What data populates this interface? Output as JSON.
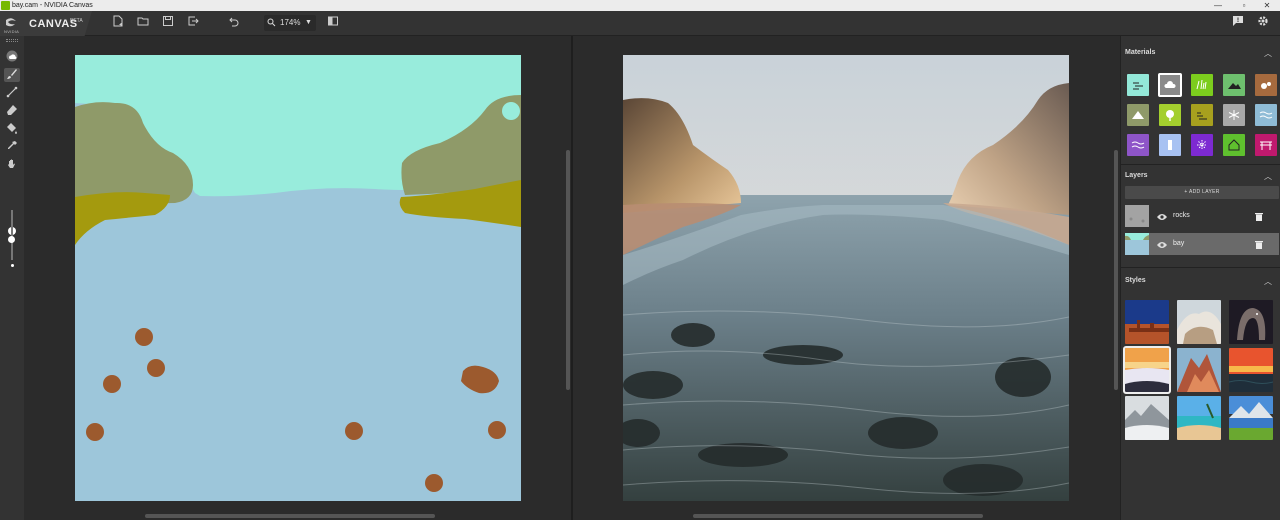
{
  "window": {
    "title": "bay.cam - NVIDIA Canvas",
    "controls": [
      "—",
      "▫",
      "✕"
    ]
  },
  "brand": {
    "logo_text": "NVIDIA",
    "app_name": "CANVAS",
    "badge": "BETA"
  },
  "toolbar": {
    "zoom_value": "174%",
    "icons": [
      "new-file-icon",
      "open-folder-icon",
      "save-icon",
      "export-icon",
      "undo-icon",
      "magnifier-icon",
      "compare-icon"
    ]
  },
  "tools": [
    "material-picker-icon",
    "brush-icon",
    "line-icon",
    "eraser-icon",
    "fill-icon",
    "eyedropper-icon",
    "pan-hand-icon"
  ],
  "panels": {
    "materials": {
      "title": "Materials",
      "swatches": [
        {
          "name": "sky",
          "color": "#93e8d8"
        },
        {
          "name": "cloud",
          "color": "#8a8a8a",
          "selected": true
        },
        {
          "name": "grass",
          "color": "#7ccd1d"
        },
        {
          "name": "hill",
          "color": "#6ec06e"
        },
        {
          "name": "dirt",
          "color": "#a66a3e"
        },
        {
          "name": "mountain",
          "color": "#8f9a69"
        },
        {
          "name": "tree",
          "color": "#a4cf2e"
        },
        {
          "name": "bush",
          "color": "#a7a01e"
        },
        {
          "name": "snow",
          "color": "#a8a8a8"
        },
        {
          "name": "water",
          "color": "#8fbcd6"
        },
        {
          "name": "river",
          "color": "#8e55c8"
        },
        {
          "name": "fog",
          "color": "#a8c2f2"
        },
        {
          "name": "sand-sparkle",
          "color": "#7d2ad2"
        },
        {
          "name": "house",
          "color": "#5fc02e"
        },
        {
          "name": "bridge",
          "color": "#c0196e"
        }
      ]
    },
    "layers": {
      "title": "Layers",
      "add_label": "+ ADD LAYER",
      "items": [
        {
          "name": "rocks",
          "active": false
        },
        {
          "name": "bay",
          "active": true
        }
      ]
    },
    "styles": {
      "title": "Styles"
    }
  },
  "colors": {
    "sky": "#98ecdc",
    "water": "#9dc6da",
    "mountain": "#8f9a69",
    "bush": "#a49a0e",
    "rock": "#9c5a2e",
    "accent": "#76b900"
  }
}
